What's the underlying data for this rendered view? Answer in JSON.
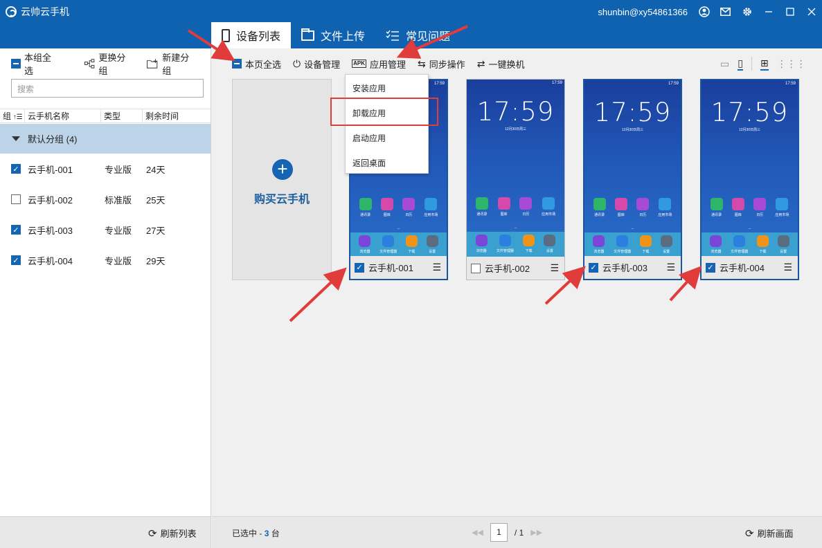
{
  "window": {
    "app_title": "云帅云手机",
    "user": "shunbin@xy54861366",
    "icons": [
      "user-icon",
      "mail-icon",
      "gear-icon",
      "minimize-icon",
      "maximize-icon",
      "close-icon"
    ]
  },
  "tabs": [
    {
      "label": "设备列表",
      "icon": "phone-icon",
      "active": true
    },
    {
      "label": "文件上传",
      "icon": "folder-icon",
      "active": false
    },
    {
      "label": "常见问题",
      "icon": "list-check-icon",
      "active": false
    }
  ],
  "left": {
    "select_all_group": "本组全选",
    "change_group": "更换分组",
    "new_group": "新建分组",
    "search_placeholder": "搜索",
    "headers": {
      "group": "组",
      "name": "云手机名称",
      "type": "类型",
      "time": "剩余时间"
    },
    "group_label": "默认分组 (4)",
    "devices": [
      {
        "name": "云手机-001",
        "type": "专业版",
        "time": "24天",
        "checked": true
      },
      {
        "name": "云手机-002",
        "type": "标准版",
        "time": "25天",
        "checked": false
      },
      {
        "name": "云手机-003",
        "type": "专业版",
        "time": "27天",
        "checked": true
      },
      {
        "name": "云手机-004",
        "type": "专业版",
        "time": "29天",
        "checked": true
      }
    ],
    "refresh_list": "刷新列表"
  },
  "toolbar": {
    "select_page": "本页全选",
    "device_manage": "设备管理",
    "app_manage": "应用管理",
    "apk_badge": "APK",
    "sync_ops": "同步操作",
    "one_click_switch": "一键换机"
  },
  "dropdown": {
    "items": [
      "安装应用",
      "卸载应用",
      "启动应用",
      "返回桌面"
    ],
    "highlighted": "卸载应用"
  },
  "buy_card": {
    "label": "购买云手机"
  },
  "phones": [
    {
      "name": "云手机-001",
      "checked": true
    },
    {
      "name": "云手机-002",
      "checked": false,
      "clock": "17:59",
      "date": "12月30日周三"
    },
    {
      "name": "云手机-003",
      "checked": true,
      "clock": "17:59",
      "date": "12月30日周三"
    },
    {
      "name": "云手机-004",
      "checked": true,
      "clock": "17:59",
      "date": "12月30日周三"
    }
  ],
  "phone_status": {
    "time": "17:59"
  },
  "phone_apps": [
    "通讯录",
    "图库",
    "日历",
    "应用市场"
  ],
  "phone_dock": [
    "浏览器",
    "文件管理器",
    "下载",
    "设置"
  ],
  "footer": {
    "selected_prefix": "已选中 -",
    "selected_count": "3",
    "selected_suffix": "台",
    "page_current": "1",
    "page_total": "/ 1",
    "refresh_screen": "刷新画面"
  },
  "colors": {
    "title_bar": "#0f62b0",
    "accent": "#1565b3",
    "annotation_red": "#e03c3c",
    "group_row": "#bdd4e8"
  }
}
